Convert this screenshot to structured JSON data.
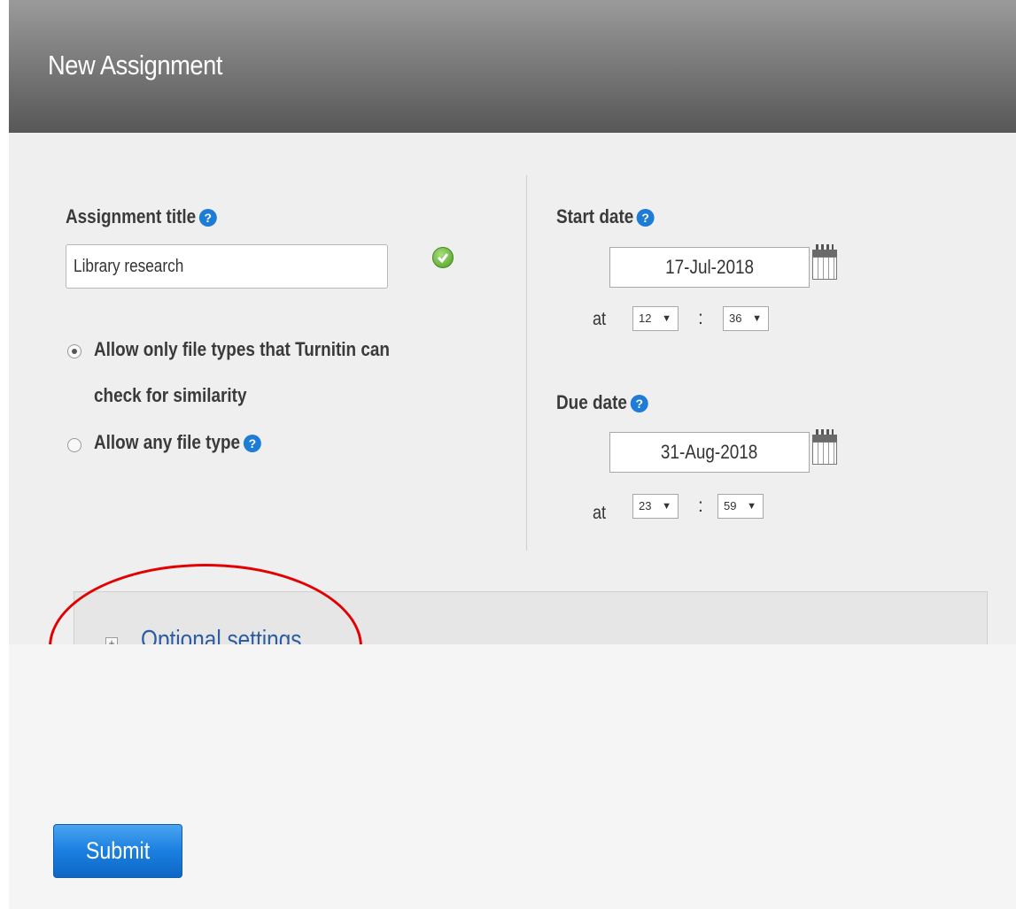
{
  "header": {
    "title": "New Assignment"
  },
  "form": {
    "assignment_title": {
      "label": "Assignment title",
      "value": "Library research"
    },
    "file_types": {
      "option_1": "Allow only file types that Turnitin can",
      "option_1_line2": "check for similarity",
      "option_2": "Allow any file type",
      "selected": "option_1"
    },
    "start": {
      "label": "Start date",
      "date": "17-Jul-2018",
      "at": "at",
      "hour": "12",
      "minute": "36"
    },
    "due": {
      "label": "Due date",
      "date": "31-Aug-2018",
      "at": "at",
      "hour": "23",
      "minute": "59"
    },
    "optional_settings": "Optional settings",
    "submit_label": "Submit"
  },
  "icons": {
    "help": "help-icon",
    "valid": "check-circle-icon",
    "calendar": "calendar-icon",
    "expand": "plus-icon"
  },
  "colors": {
    "accent": "#1d7cd6",
    "annotation": "#e30000",
    "link": "#2d5da0"
  }
}
